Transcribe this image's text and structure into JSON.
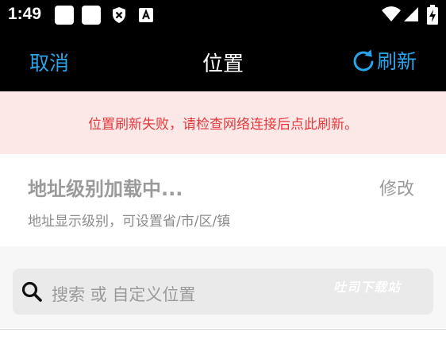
{
  "status_bar": {
    "time": "1:49",
    "notification_icons": [
      "app-notification-icon",
      "app-notification-icon",
      "shield-icon",
      "a-badge-icon"
    ],
    "system_icons": [
      "wifi-icon",
      "cellular-signal-icon",
      "battery-charging-icon"
    ]
  },
  "navbar": {
    "cancel_label": "取消",
    "title": "位置",
    "refresh_label": "刷新",
    "refresh_icon": "refresh-icon"
  },
  "error_banner": {
    "message": "位置刷新失败，请检查网络连接后点此刷新。"
  },
  "address_level": {
    "title": "地址级别加载中...",
    "edit_label": "修改",
    "description": "地址显示级别，可设置省/市/区/镇"
  },
  "search": {
    "icon": "search-icon",
    "placeholder": "搜索 或 自定义位置"
  },
  "watermark": {
    "text": "吐司下载站"
  },
  "colors": {
    "accent": "#2aa4e8",
    "error_text": "#e4393c",
    "error_bg": "#fde8e8",
    "bar_bg": "#000000"
  }
}
